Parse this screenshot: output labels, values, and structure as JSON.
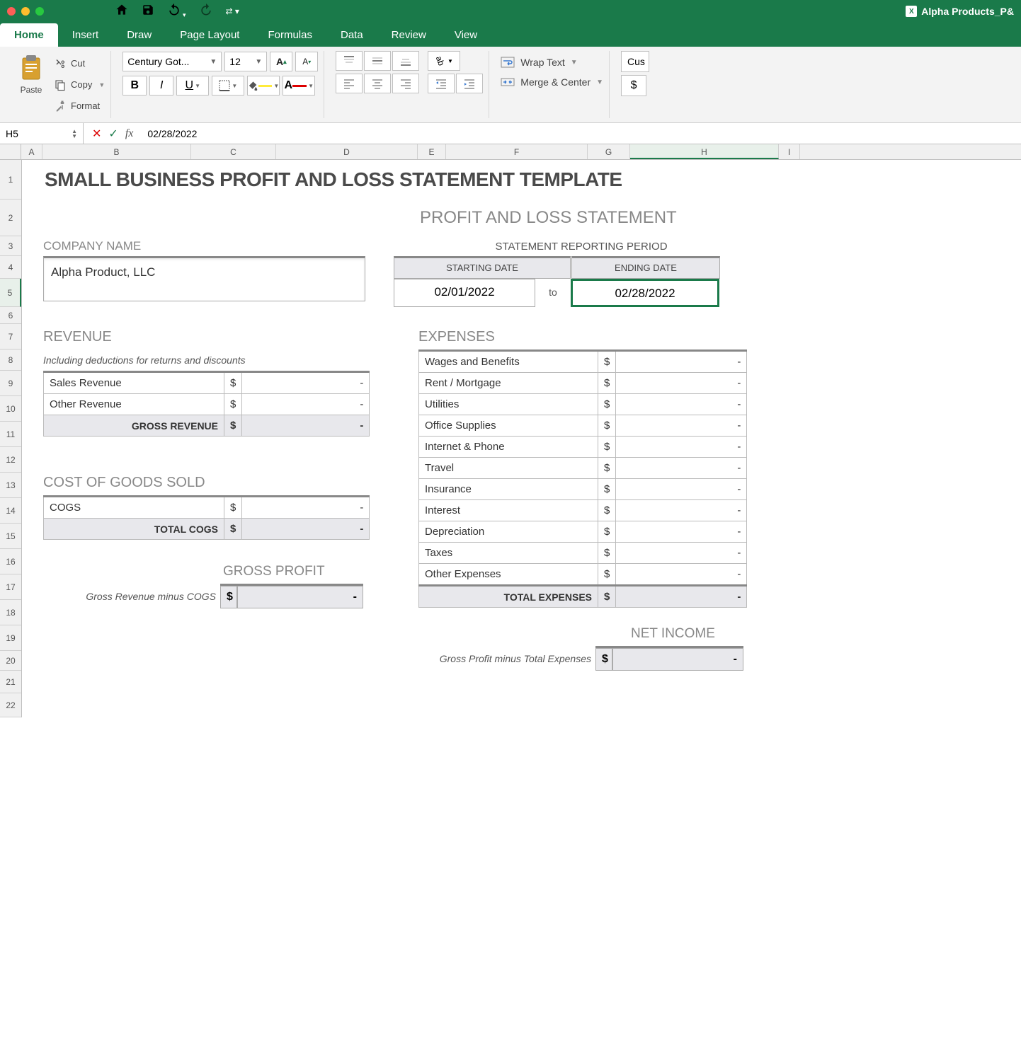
{
  "window": {
    "doc_title": "Alpha Products_P&"
  },
  "ribbon": {
    "tabs": [
      "Home",
      "Insert",
      "Draw",
      "Page Layout",
      "Formulas",
      "Data",
      "Review",
      "View"
    ],
    "paste": "Paste",
    "cut": "Cut",
    "copy": "Copy",
    "format": "Format",
    "font_name": "Century Got...",
    "font_size": "12",
    "wrap": "Wrap Text",
    "merge": "Merge & Center",
    "num_fmt": "Cus",
    "currency": "$"
  },
  "formula_bar": {
    "name_box": "H5",
    "value": "02/28/2022"
  },
  "columns": [
    "A",
    "B",
    "C",
    "D",
    "E",
    "F",
    "G",
    "H",
    "I"
  ],
  "rows": [
    "1",
    "2",
    "3",
    "4",
    "5",
    "6",
    "7",
    "8",
    "9",
    "10",
    "11",
    "12",
    "13",
    "14",
    "15",
    "16",
    "17",
    "18",
    "19",
    "20",
    "21",
    "22"
  ],
  "sheet": {
    "title": "SMALL BUSINESS PROFIT AND LOSS STATEMENT TEMPLATE",
    "subtitle": "PROFIT AND LOSS STATEMENT",
    "company_label": "COMPANY NAME",
    "company_value": "Alpha Product, LLC",
    "period_label": "STATEMENT REPORTING PERIOD",
    "starting_label": "STARTING DATE",
    "ending_label": "ENDING DATE",
    "start_date": "02/01/2022",
    "to": "to",
    "end_date": "02/28/2022",
    "revenue_h": "REVENUE",
    "revenue_note": "Including deductions for returns and discounts",
    "revenue_rows": [
      {
        "label": "Sales Revenue",
        "curr": "$",
        "val": "-"
      },
      {
        "label": "Other Revenue",
        "curr": "$",
        "val": "-"
      }
    ],
    "gross_revenue_label": "GROSS REVENUE",
    "gross_revenue_curr": "$",
    "gross_revenue_val": "-",
    "cogs_h": "COST OF GOODS SOLD",
    "cogs_rows": [
      {
        "label": "COGS",
        "curr": "$",
        "val": "-"
      }
    ],
    "total_cogs_label": "TOTAL COGS",
    "total_cogs_curr": "$",
    "total_cogs_val": "-",
    "gp_h": "GROSS PROFIT",
    "gp_note": "Gross Revenue minus COGS",
    "gp_curr": "$",
    "gp_val": "-",
    "expenses_h": "EXPENSES",
    "expense_rows": [
      {
        "label": "Wages and Benefits",
        "curr": "$",
        "val": "-"
      },
      {
        "label": "Rent / Mortgage",
        "curr": "$",
        "val": "-"
      },
      {
        "label": "Utilities",
        "curr": "$",
        "val": "-"
      },
      {
        "label": "Office Supplies",
        "curr": "$",
        "val": "-"
      },
      {
        "label": "Internet & Phone",
        "curr": "$",
        "val": "-"
      },
      {
        "label": "Travel",
        "curr": "$",
        "val": "-"
      },
      {
        "label": "Insurance",
        "curr": "$",
        "val": "-"
      },
      {
        "label": "Interest",
        "curr": "$",
        "val": "-"
      },
      {
        "label": "Depreciation",
        "curr": "$",
        "val": "-"
      },
      {
        "label": "Taxes",
        "curr": "$",
        "val": "-"
      },
      {
        "label": "Other Expenses",
        "curr": "$",
        "val": "-"
      }
    ],
    "total_exp_label": "TOTAL EXPENSES",
    "total_exp_curr": "$",
    "total_exp_val": "-",
    "ni_h": "NET INCOME",
    "ni_note": "Gross Profit minus Total Expenses",
    "ni_curr": "$",
    "ni_val": "-"
  }
}
